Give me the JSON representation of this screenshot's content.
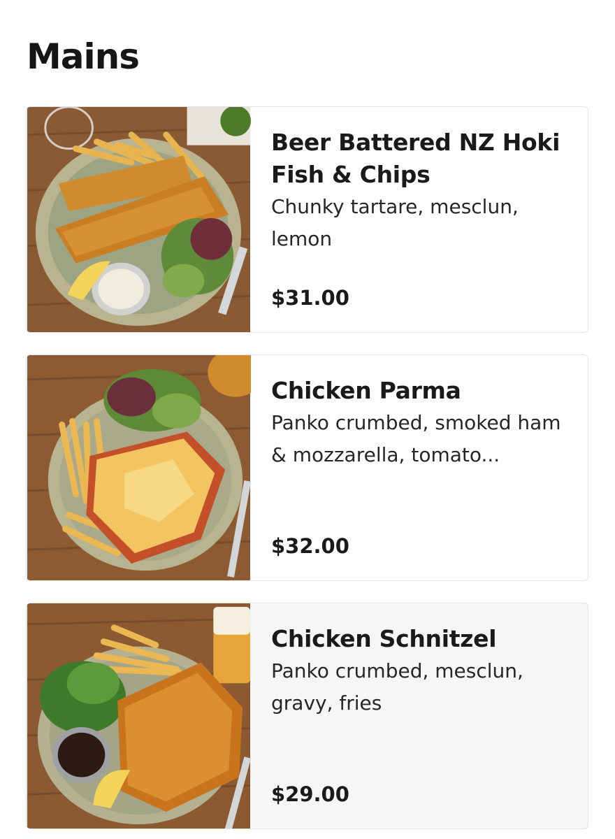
{
  "section": {
    "title": "Mains"
  },
  "items": [
    {
      "name": "Beer Battered NZ Hoki Fish & Chips",
      "description": "Chunky tartare, mesclun, lemon",
      "price": "$31.00"
    },
    {
      "name": "Chicken Parma",
      "description": "Panko crumbed, smoked ham & mozzarella, tomato...",
      "price": "$32.00"
    },
    {
      "name": "Chicken Schnitzel",
      "description": "Panko crumbed, mesclun, gravy, fries",
      "price": "$29.00"
    }
  ]
}
